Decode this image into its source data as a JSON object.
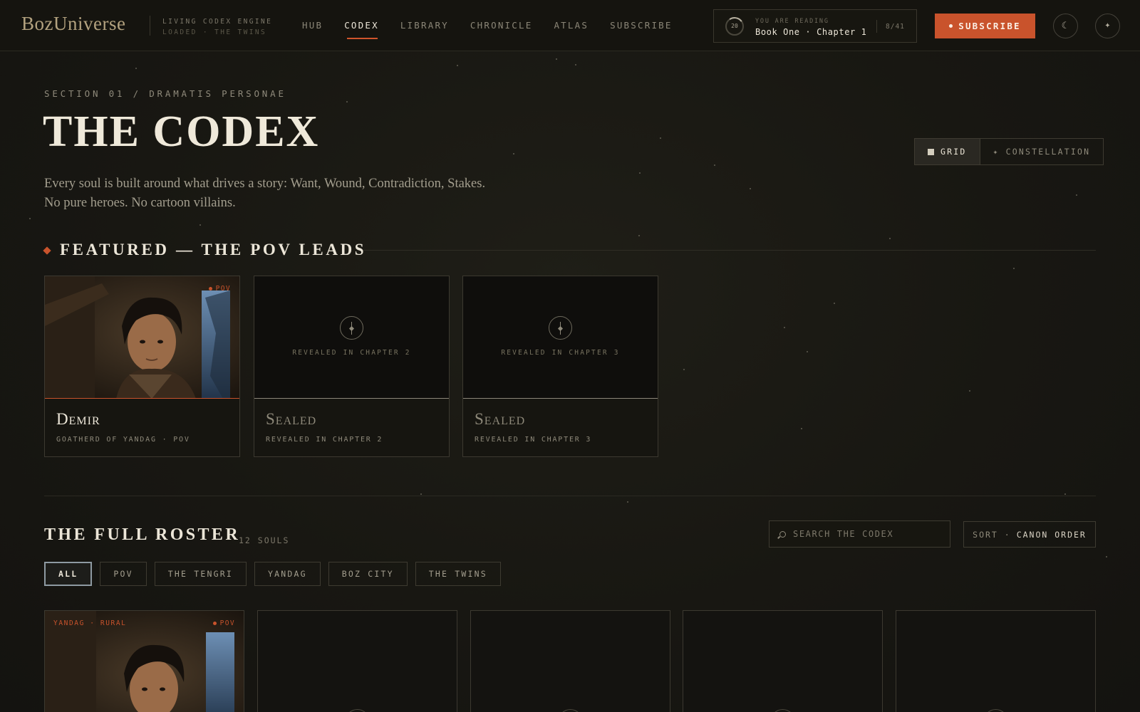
{
  "brand": {
    "logo": "BozUniverse",
    "engine_line1": "LIVING CODEX ENGINE",
    "engine_line2": "LOADED · THE TWINS"
  },
  "nav": {
    "items": [
      {
        "label": "HUB",
        "active": false
      },
      {
        "label": "CODEX",
        "active": true
      },
      {
        "label": "LIBRARY",
        "active": false
      },
      {
        "label": "CHRONICLE",
        "active": false
      },
      {
        "label": "ATLAS",
        "active": false
      },
      {
        "label": "SUBSCRIBE",
        "active": false
      }
    ]
  },
  "reading": {
    "progress": "20",
    "label": "YOU ARE READING",
    "value": "Book One · Chapter 1",
    "page": "8/41"
  },
  "header_actions": {
    "subscribe_label": "SUBSCRIBE",
    "theme_icon": "moon-icon",
    "theme_glyph": "☾",
    "extra_icon": "sparkle-icon",
    "extra_glyph": "✦"
  },
  "hero": {
    "section_label": "SECTION 01 / DRAMATIS PERSONAE",
    "title": "THE CODEX",
    "lede": "Every soul is built around what drives a story: Want, Wound, Contradiction, Stakes. No pure heroes. No cartoon villains."
  },
  "view_toggle": {
    "grid_label": "GRID",
    "constellation_label": "CONSTELLATION",
    "constellation_glyph": "✦",
    "active": "grid"
  },
  "featured": {
    "heading": "FEATURED — THE POV LEADS",
    "cards": [
      {
        "name": "Demir",
        "role": "GOATHERD OF YANDAG · POV",
        "tag": "POV",
        "sealed": false
      },
      {
        "name": "Sealed",
        "role": "REVEALED IN CHAPTER 2",
        "seal_text": "REVEALED IN CHAPTER 2",
        "sealed": true
      },
      {
        "name": "Sealed",
        "role": "REVEALED IN CHAPTER 3",
        "seal_text": "REVEALED IN CHAPTER 3",
        "sealed": true
      }
    ]
  },
  "roster": {
    "title": "THE FULL ROSTER",
    "count": "12 SOULS",
    "search_placeholder": "SEARCH THE CODEX",
    "sort_label": "SORT ·",
    "sort_value": "CANON ORDER",
    "filters": [
      {
        "label": "ALL",
        "active": true
      },
      {
        "label": "POV",
        "active": false
      },
      {
        "label": "THE TENGRI",
        "active": false
      },
      {
        "label": "YANDAG",
        "active": false
      },
      {
        "label": "BOZ CITY",
        "active": false
      },
      {
        "label": "THE TWINS",
        "active": false
      }
    ],
    "cards": [
      {
        "region": "YANDAG · RURAL",
        "tag": "POV",
        "sealed": false
      },
      {
        "sealed": true
      },
      {
        "sealed": true
      },
      {
        "sealed": true
      },
      {
        "sealed": true
      }
    ]
  },
  "colors": {
    "accent": "#c9532c",
    "background": "#181712",
    "text": "#ece6d8"
  }
}
